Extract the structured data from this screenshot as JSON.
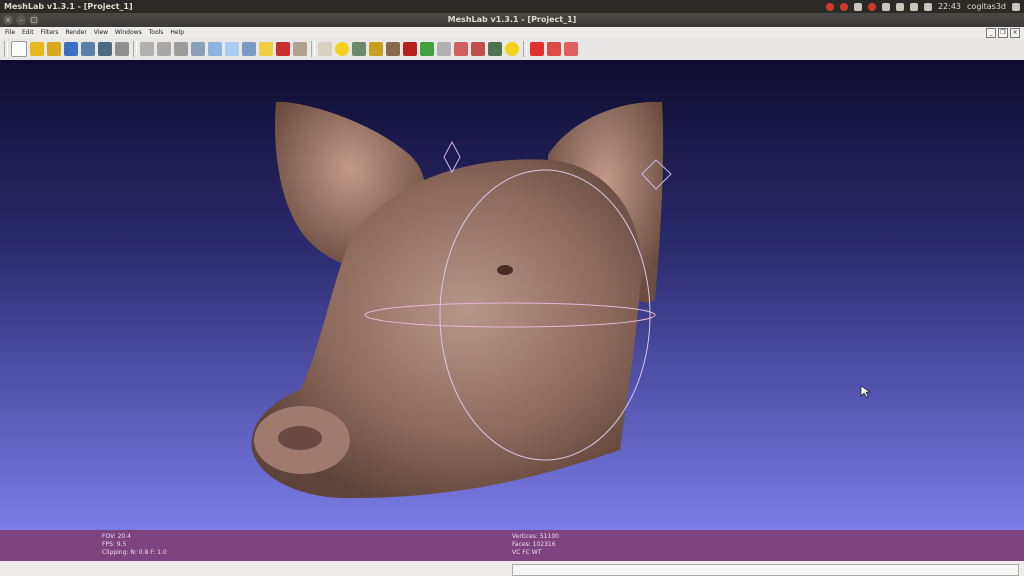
{
  "topbar": {
    "app_name": "MeshLab v1.3.1 - [Project_1]",
    "time": "22:43",
    "user": "cogitas3d"
  },
  "window": {
    "title": "MeshLab v1.3.1 - [Project_1]"
  },
  "menu": [
    "File",
    "Edit",
    "Filters",
    "Render",
    "View",
    "Windows",
    "Tools",
    "Help"
  ],
  "status": {
    "fov": "FOV: 20.4",
    "fps": "FPS:    9.5",
    "clipping": "Clipping: N:   0.8 F:    1.0",
    "vertices": "Vertices: 51100",
    "faces": "Faces: 102316",
    "flags": "VC FC WT"
  },
  "colors": {
    "status_bg": "#7d437e",
    "viewport_top": "#0e0c2e",
    "viewport_bottom": "#7c7ce6"
  }
}
